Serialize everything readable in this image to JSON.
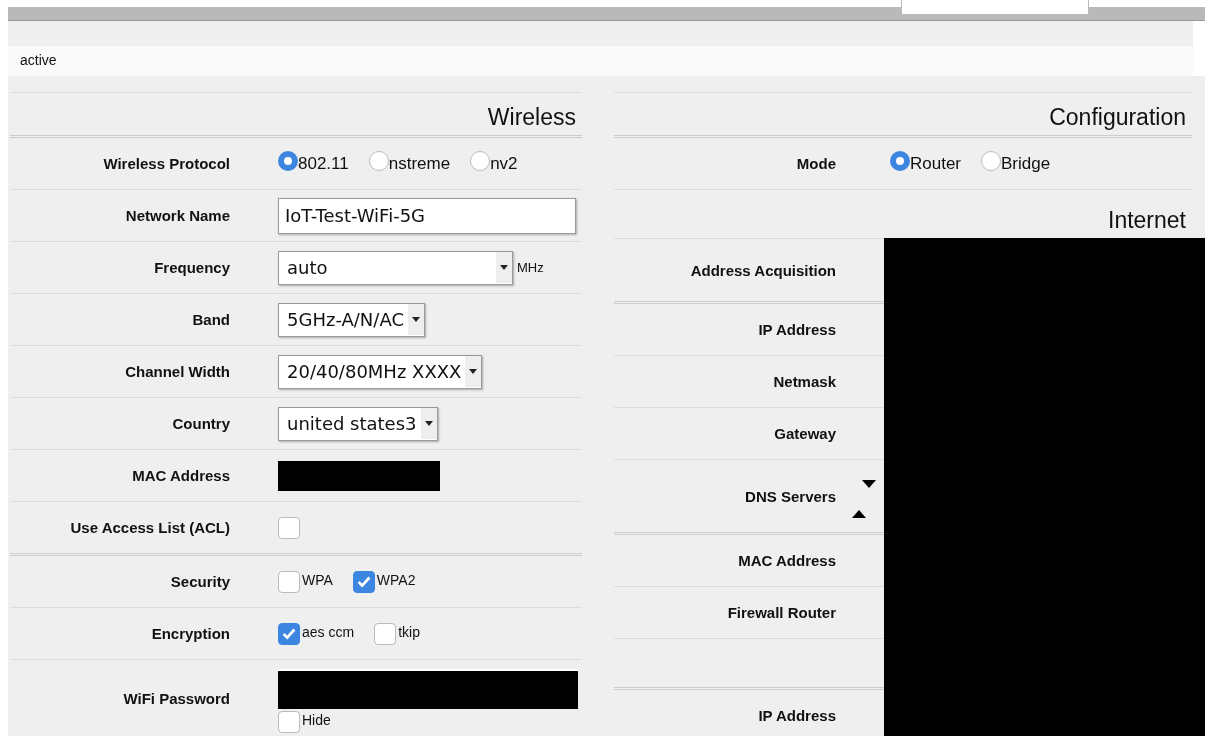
{
  "status": "active",
  "wireless": {
    "title": "Wireless",
    "rows": [
      {
        "label": "Wireless Protocol",
        "kind": "radio",
        "options": [
          {
            "label": "802.11",
            "selected": true
          },
          {
            "label": "nstreme",
            "selected": false
          },
          {
            "label": "nv2",
            "selected": false
          }
        ]
      },
      {
        "label": "Network Name",
        "kind": "text",
        "value": "IoT-Test-WiFi-5G"
      },
      {
        "label": "Frequency",
        "kind": "select",
        "value": "auto",
        "unit": "MHz"
      },
      {
        "label": "Band",
        "kind": "select",
        "value": "5GHz-A/N/AC"
      },
      {
        "label": "Channel Width",
        "kind": "select",
        "value": "20/40/80MHz XXXX"
      },
      {
        "label": "Country",
        "kind": "select",
        "value": "united states3"
      },
      {
        "label": "MAC Address",
        "kind": "redacted"
      },
      {
        "label": "Use Access List (ACL)",
        "kind": "checkbox",
        "checked": false,
        "section_end": true
      },
      {
        "label": "Security",
        "kind": "checks",
        "options": [
          {
            "label": "WPA",
            "checked": false
          },
          {
            "label": "WPA2",
            "checked": true
          }
        ]
      },
      {
        "label": "Encryption",
        "kind": "checks",
        "options": [
          {
            "label": "aes ccm",
            "checked": true
          },
          {
            "label": "tkip",
            "checked": false
          }
        ]
      },
      {
        "label": "WiFi Password",
        "kind": "password",
        "hide": {
          "label": "Hide",
          "checked": false
        }
      }
    ]
  },
  "configuration": {
    "title": "Configuration",
    "mode": {
      "label": "Mode",
      "options": [
        {
          "label": "Router",
          "selected": true
        },
        {
          "label": "Bridge",
          "selected": false
        }
      ]
    },
    "internet": {
      "title": "Internet",
      "redacted": true,
      "rows": [
        {
          "label": "Address Acquisition",
          "kind": "plain",
          "section_end": true
        },
        {
          "label": "IP Address",
          "kind": "plain"
        },
        {
          "label": "Netmask",
          "kind": "plain"
        },
        {
          "label": "Gateway",
          "kind": "plain"
        },
        {
          "label": "DNS Servers",
          "kind": "list",
          "section_end": true
        },
        {
          "label": "MAC Address",
          "kind": "plain"
        },
        {
          "label": "Firewall Router",
          "kind": "plain"
        },
        {
          "kind": "blank",
          "section_end": true
        },
        {
          "label": "IP Address",
          "kind": "plain"
        }
      ]
    }
  }
}
